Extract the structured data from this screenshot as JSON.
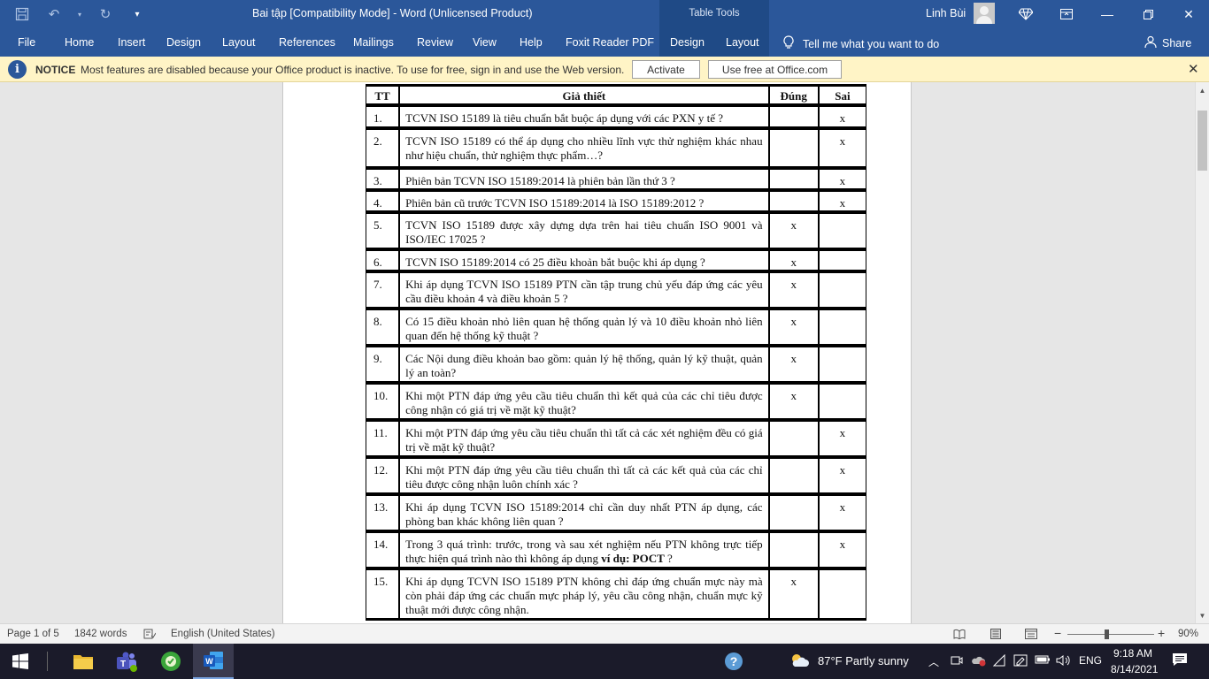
{
  "title_bar": {
    "document_title": "Bai tập [Compatibility Mode]  -  Word (Unlicensed Product)",
    "table_tools": "Table Tools",
    "user_name": "Linh Bùi"
  },
  "ribbon": {
    "tabs": [
      "File",
      "Home",
      "Insert",
      "Design",
      "Layout",
      "References",
      "Mailings",
      "Review",
      "View",
      "Help",
      "Foxit Reader PDF",
      "Design",
      "Layout"
    ],
    "tell_me": "Tell me what you want to do",
    "share": "Share"
  },
  "notice": {
    "label": "NOTICE",
    "text": "Most features are disabled because your Office product is inactive. To use for free, sign in and use the Web version.",
    "activate": "Activate",
    "use_free": "Use free at Office.com"
  },
  "table": {
    "headers": [
      "TT",
      "Giả thiết",
      "Đúng",
      "Sai"
    ],
    "rows": [
      {
        "tt": "1.",
        "q": "TCVN ISO 15189 là tiêu chuẩn bắt buộc áp dụng với các PXN y tế ?",
        "dung": "",
        "sai": "x"
      },
      {
        "tt": "2.",
        "q": "TCVN ISO 15189 có thể áp dụng cho nhiều lĩnh vực thử nghiệm khác nhau như hiệu chuẩn, thử nghiệm thực phẩm…?",
        "dung": "",
        "sai": "x"
      },
      {
        "tt": "3.",
        "q": "Phiên bản TCVN ISO 15189:2014 là phiên bản lần thứ 3 ?",
        "dung": "",
        "sai": "x"
      },
      {
        "tt": "4.",
        "q": "Phiên bản cũ trước TCVN ISO 15189:2014 là ISO 15189:2012 ?",
        "dung": "",
        "sai": "x"
      },
      {
        "tt": "5.",
        "q": "TCVN ISO 15189 được xây dựng dựa trên hai tiêu chuẩn ISO 9001 và ISO/IEC 17025 ?",
        "dung": "x",
        "sai": ""
      },
      {
        "tt": "6.",
        "q": "TCVN ISO 15189:2014 có 25 điều khoản bắt buộc khi áp dụng ?",
        "dung": "x",
        "sai": ""
      },
      {
        "tt": "7.",
        "q": "Khi áp dụng TCVN ISO 15189 PTN cần tập trung chủ yếu đáp ứng các yêu cầu điều khoản 4 và điều khoản 5 ?",
        "dung": "x",
        "sai": ""
      },
      {
        "tt": "8.",
        "q": "Có 15 điều khoản nhỏ liên quan hệ thống quản lý và 10 điều khoản nhỏ liên quan đến hệ thống kỹ thuật ?",
        "dung": "x",
        "sai": ""
      },
      {
        "tt": "9.",
        "q": "Các Nội dung điều khoản bao gồm: quản lý hệ thống, quản lý kỹ thuật, quản lý an toàn?",
        "dung": "x",
        "sai": ""
      },
      {
        "tt": "10.",
        "q": "Khi một PTN đáp ứng yêu cầu tiêu chuẩn thì kết quả của các chỉ tiêu được công nhận có giá trị về mặt kỹ thuật?",
        "dung": "x",
        "sai": ""
      },
      {
        "tt": "11.",
        "q": "Khi một PTN đáp ứng yêu cầu tiêu chuẩn thì tất cả các xét nghiệm đều có giá trị về mặt kỹ thuật?",
        "dung": "",
        "sai": "x"
      },
      {
        "tt": "12.",
        "q": "Khi một PTN đáp ứng yêu cầu tiêu chuẩn thì tất cả các kết quả của các chỉ tiêu được công nhận luôn chính xác ?",
        "dung": "",
        "sai": "x"
      },
      {
        "tt": "13.",
        "q": "Khi áp dụng TCVN ISO 15189:2014 chỉ cần duy nhất PTN áp dụng, các phòng ban khác không liên quan ?",
        "dung": "",
        "sai": "x"
      },
      {
        "tt": "14.",
        "q": "Trong 3 quá trình: trước, trong và sau xét nghiệm nếu PTN không trực tiếp thực hiện quá trình nào thì không áp dụng ",
        "q_bold": "ví dụ: POCT",
        "q_tail": " ?",
        "dung": "",
        "sai": "x"
      },
      {
        "tt": "15.",
        "q": "Khi áp dụng TCVN ISO 15189 PTN không chỉ đáp ứng chuẩn mực này mà còn phải đáp ứng các chuẩn mực pháp lý, yêu cầu công nhận, chuẩn mực kỹ thuật mới được công nhận.",
        "dung": "x",
        "sai": ""
      }
    ]
  },
  "status_bar": {
    "page": "Page 1 of 5",
    "words": "1842 words",
    "language": "English (United States)",
    "zoom": "90%",
    "zoom_level": 0.45
  },
  "taskbar": {
    "weather": "87°F  Partly sunny",
    "lang": "ENG",
    "time": "9:18 AM",
    "date": "8/14/2021"
  },
  "colors": {
    "ribbon": "#2b579a",
    "notice_bg": "#fff4c6",
    "taskbar": "#1b1b2a"
  }
}
